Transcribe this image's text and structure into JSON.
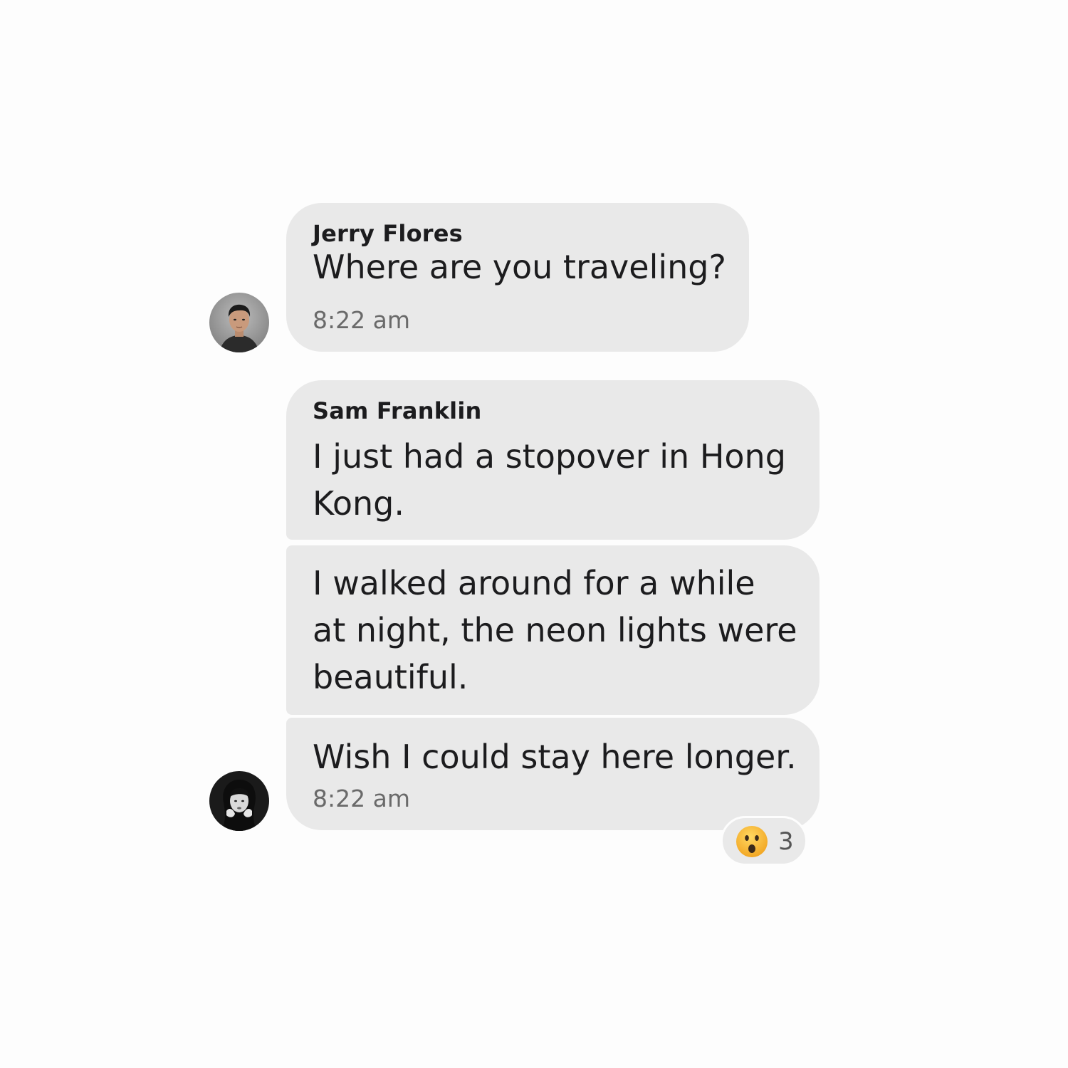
{
  "conversation": {
    "messages": [
      {
        "sender": "Jerry Flores",
        "text": "Where are you traveling?",
        "time": "8:22 am"
      },
      {
        "sender": "Sam Franklin",
        "text": "I just had a stopover in Hong Kong."
      },
      {
        "text": "I walked around for a while at night, the neon lights were beautiful."
      },
      {
        "text": "Wish I could stay here longer.",
        "time": "8:22 am",
        "reaction": {
          "emoji": "astonished-face-icon",
          "count": "3"
        }
      }
    ]
  },
  "colors": {
    "background": "#fdfdfd",
    "bubble": "#e9e9e9",
    "text": "#1c1c1e",
    "timestamp": "#6a6a6a",
    "emoji_face": "#f5b83a"
  }
}
